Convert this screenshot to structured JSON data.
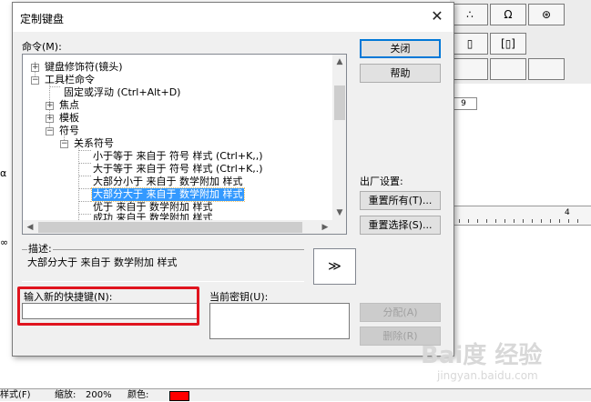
{
  "background": {
    "toolbar_buttons": [
      "∴",
      "Ω",
      "⊛",
      "▯",
      "[▯]"
    ],
    "tab_label": "9",
    "ruler_number": "4",
    "left_glyphs": [
      "α",
      "∞"
    ],
    "status": {
      "style_label": "样式(F)",
      "zoom_label": "缩放:",
      "zoom_value": "200%",
      "color_label": "颜色:",
      "color_value": "#ff0000"
    }
  },
  "dialog": {
    "title": "定制键盘",
    "commands_label": "命令(M):",
    "tree": [
      {
        "text": "键盘修饰符(镜头)",
        "level": 1,
        "expander": "+"
      },
      {
        "text": "工具栏命令",
        "level": 1,
        "expander": "-"
      },
      {
        "text": "固定或浮动 (Ctrl+Alt+D)",
        "level": 2,
        "expander": ""
      },
      {
        "text": "焦点",
        "level": 2,
        "expander": "+"
      },
      {
        "text": "模板",
        "level": 2,
        "expander": "+"
      },
      {
        "text": "符号",
        "level": 2,
        "expander": "-"
      },
      {
        "text": "关系符号",
        "level": 3,
        "expander": "-"
      },
      {
        "text": "小于等于 来自于 符号 样式 (Ctrl+K,,)",
        "level": 4,
        "expander": ""
      },
      {
        "text": "大于等于 来自于 符号 样式 (Ctrl+K,.)",
        "level": 4,
        "expander": ""
      },
      {
        "text": "大部分小于 来自于 数学附加 样式",
        "level": 4,
        "expander": ""
      },
      {
        "text": "大部分大于 来自于 数学附加 样式",
        "level": 4,
        "expander": "",
        "selected": true
      },
      {
        "text": "优于 来自于 数学附加 样式",
        "level": 4,
        "expander": ""
      },
      {
        "text": "成功 来自于 数学附加 样式",
        "level": 4,
        "expander": ""
      }
    ],
    "buttons": {
      "close": "关闭",
      "help": "帮助",
      "reset_all": "重置所有(T)...",
      "reset_selection": "重置选择(S)...",
      "assign": "分配(A)",
      "remove": "删除(R)"
    },
    "factory_settings_label": "出厂设置:",
    "description_label": "描述:",
    "description_text": "大部分大于 来自于 数学附加 样式",
    "preview_symbol": "≫",
    "new_shortcut_label": "输入新的快捷键(N):",
    "new_shortcut_value": "",
    "current_keys_label": "当前密钥(U):",
    "current_keys_value": ""
  },
  "watermark": {
    "main": "Bai度 经验",
    "sub": "jingyan.baidu.com"
  },
  "colors": {
    "highlight": "#e0141e",
    "selection": "#3399ff",
    "accent": "#0078d7"
  }
}
